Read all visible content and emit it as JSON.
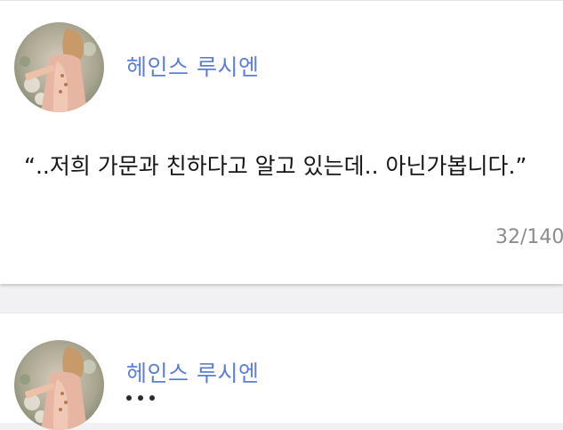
{
  "messages": [
    {
      "speaker": "헤인스 루시엔",
      "avatar_icon": "character-portrait-avatar",
      "text": "“..저희 가문과 친하다고 알고 있는데.. 아닌가봅니다.”",
      "char_count": "32/140"
    },
    {
      "speaker": "헤인스 루시엔",
      "avatar_icon": "character-portrait-avatar",
      "status_icon": "typing-indicator-icon"
    }
  ],
  "colors": {
    "speaker_name": "#5c7fd6",
    "message_text": "#161616",
    "counter_text": "#8c8c8c",
    "page_background": "#f1f1f3",
    "card_background": "#ffffff"
  }
}
